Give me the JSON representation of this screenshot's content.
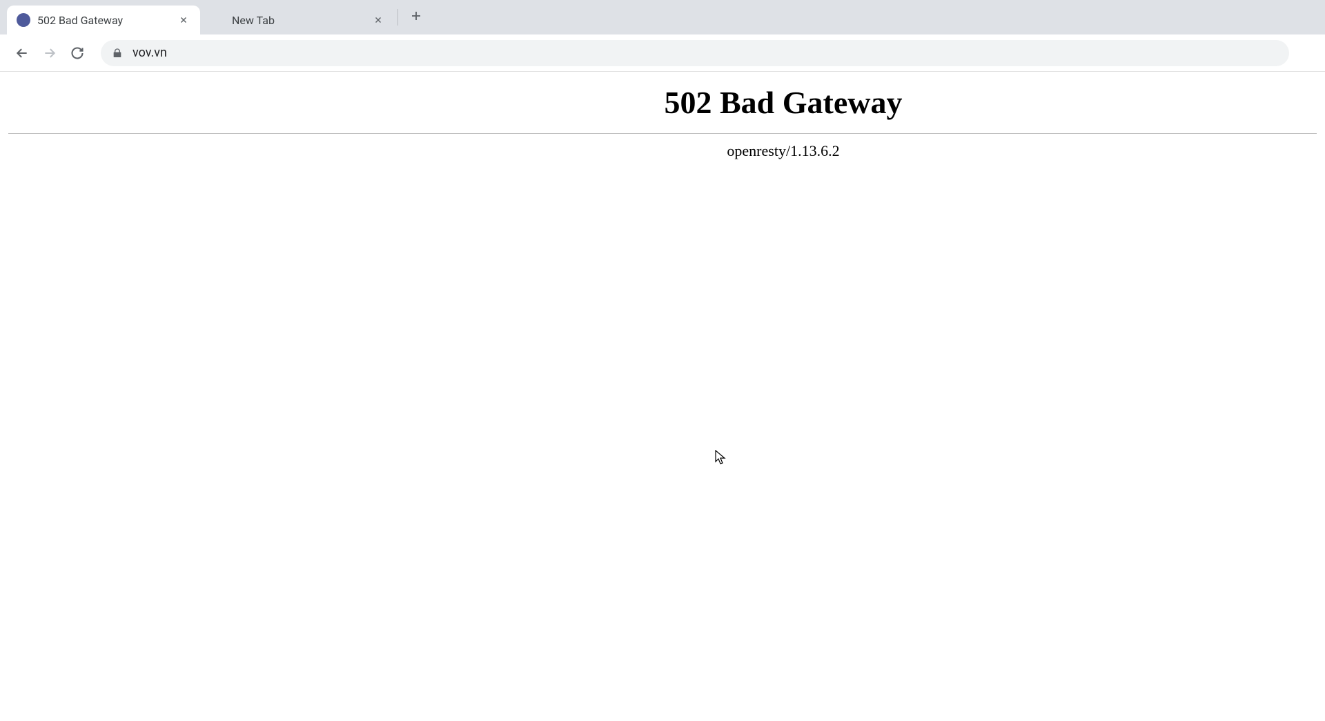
{
  "tabs": [
    {
      "title": "502 Bad Gateway",
      "active": true
    },
    {
      "title": "New Tab",
      "active": false
    }
  ],
  "address_bar": {
    "url": "vov.vn"
  },
  "page": {
    "heading": "502 Bad Gateway",
    "server": "openresty/1.13.6.2"
  }
}
